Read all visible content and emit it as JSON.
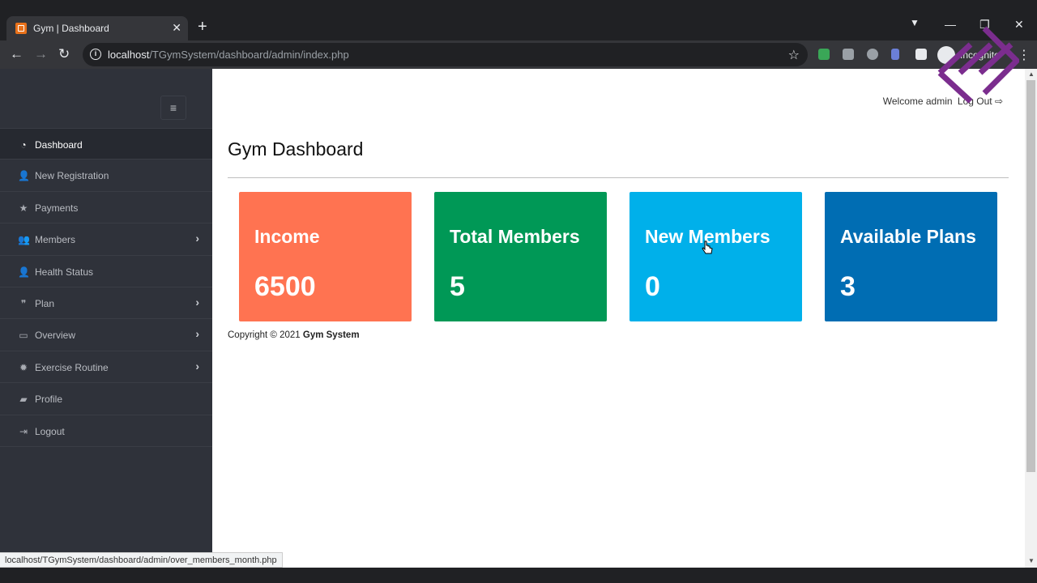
{
  "browser": {
    "tab_title": "Gym | Dashboard",
    "tab_close": "✕",
    "new_tab": "+",
    "win_min": "—",
    "win_max": "❐",
    "win_close": "✕",
    "back": "←",
    "forward": "→",
    "reload": "↻",
    "info": "i",
    "url_host": "localhost",
    "url_path": "/TGymSystem/dashboard/admin/index.php",
    "star": "☆",
    "incognito_label": "Incognito",
    "menu": "⋮",
    "status_url": "localhost/TGymSystem/dashboard/admin/over_members_month.php"
  },
  "sidebar": {
    "toggle": "≡",
    "items": [
      {
        "label": "Dashboard",
        "icon": "dashboard-icon",
        "glyph": "◔",
        "chevron": ""
      },
      {
        "label": "New Registration",
        "icon": "user-plus-icon",
        "glyph": "👤",
        "chevron": ""
      },
      {
        "label": "Payments",
        "icon": "star-icon",
        "glyph": "★",
        "chevron": ""
      },
      {
        "label": "Members",
        "icon": "users-icon",
        "glyph": "👥",
        "chevron": "›"
      },
      {
        "label": "Health Status",
        "icon": "user-plus-icon",
        "glyph": "👤",
        "chevron": ""
      },
      {
        "label": "Plan",
        "icon": "quote-icon",
        "glyph": "❞",
        "chevron": "›"
      },
      {
        "label": "Overview",
        "icon": "archive-icon",
        "glyph": "▭",
        "chevron": "›"
      },
      {
        "label": "Exercise Routine",
        "icon": "gear-icon",
        "glyph": "✹",
        "chevron": "›"
      },
      {
        "label": "Profile",
        "icon": "folder-icon",
        "glyph": "▰",
        "chevron": ""
      },
      {
        "label": "Logout",
        "icon": "sign-out-icon",
        "glyph": "⇥",
        "chevron": ""
      }
    ]
  },
  "header": {
    "welcome": "Welcome admin",
    "logout": "Log Out ⇨"
  },
  "main": {
    "title": "Gym Dashboard",
    "cards": [
      {
        "title": "Income",
        "value": "6500",
        "color": "#ff7351"
      },
      {
        "title": "Total Members",
        "value": "5",
        "color": "#009856"
      },
      {
        "title": "New Members",
        "value": "0",
        "color": "#00b0ea"
      },
      {
        "title": "Available Plans",
        "value": "3",
        "color": "#006db3"
      }
    ],
    "copyright_prefix": "Copyright © 2021",
    "copyright_brand": "Gym System"
  }
}
